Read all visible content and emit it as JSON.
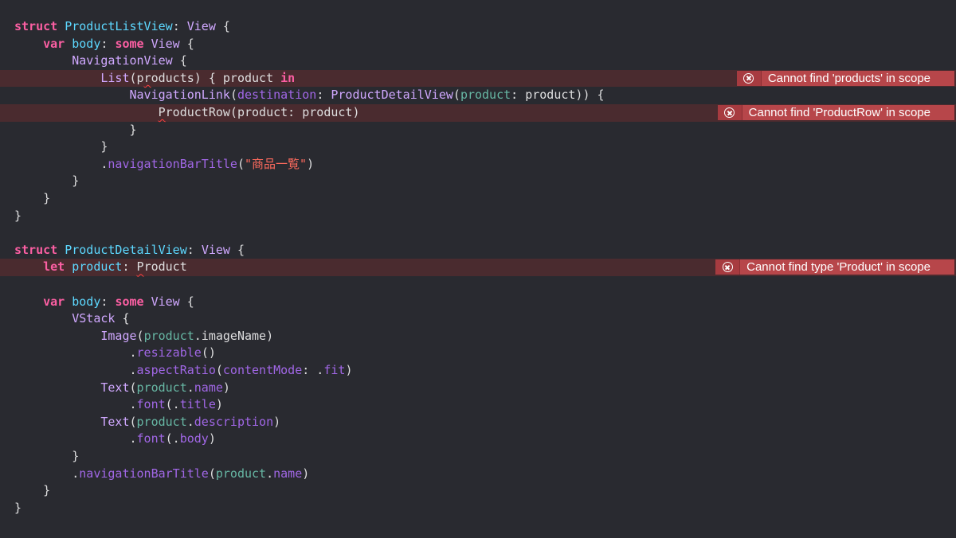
{
  "editor": {
    "lines": [
      [
        [
          "kw",
          "struct "
        ],
        [
          "decl",
          "ProductListView"
        ],
        [
          "plain",
          ": "
        ],
        [
          "type",
          "View"
        ],
        [
          "plain",
          " {"
        ]
      ],
      [
        [
          "plain",
          "    "
        ],
        [
          "kw",
          "var "
        ],
        [
          "decl",
          "body"
        ],
        [
          "plain",
          ": "
        ],
        [
          "kw",
          "some "
        ],
        [
          "type",
          "View"
        ],
        [
          "plain",
          " {"
        ]
      ],
      [
        [
          "plain",
          "        "
        ],
        [
          "type",
          "NavigationView"
        ],
        [
          "plain",
          " {"
        ]
      ],
      [
        [
          "plain",
          "            "
        ],
        [
          "type",
          "List"
        ],
        [
          "plain",
          "("
        ],
        [
          "plain",
          "p"
        ],
        [
          "squig",
          "r"
        ],
        [
          "plain",
          "oducts) { product "
        ],
        [
          "kw",
          "in"
        ]
      ],
      [
        [
          "plain",
          "                "
        ],
        [
          "type",
          "NavigationLink"
        ],
        [
          "plain",
          "("
        ],
        [
          "func",
          "destination"
        ],
        [
          "plain",
          ": "
        ],
        [
          "type",
          "ProductDetailView"
        ],
        [
          "plain",
          "("
        ],
        [
          "prop",
          "product"
        ],
        [
          "plain",
          ": product)) {"
        ]
      ],
      [
        [
          "plain",
          "                    "
        ],
        [
          "squig",
          "P"
        ],
        [
          "plain",
          "roductRow(product: product)"
        ]
      ],
      [
        [
          "plain",
          "                }"
        ]
      ],
      [
        [
          "plain",
          "            }"
        ]
      ],
      [
        [
          "plain",
          "            ."
        ],
        [
          "func",
          "navigationBarTitle"
        ],
        [
          "plain",
          "("
        ],
        [
          "str",
          "\"商品一覧\""
        ],
        [
          "plain",
          ")"
        ]
      ],
      [
        [
          "plain",
          "        }"
        ]
      ],
      [
        [
          "plain",
          "    }"
        ]
      ],
      [
        [
          "plain",
          "}"
        ]
      ],
      [],
      [
        [
          "kw",
          "struct "
        ],
        [
          "decl",
          "ProductDetailView"
        ],
        [
          "plain",
          ": "
        ],
        [
          "type",
          "View"
        ],
        [
          "plain",
          " {"
        ]
      ],
      [
        [
          "plain",
          "    "
        ],
        [
          "kw",
          "let "
        ],
        [
          "decl",
          "product"
        ],
        [
          "plain",
          ": "
        ],
        [
          "squig",
          "P"
        ],
        [
          "plain",
          "roduct"
        ]
      ],
      [],
      [
        [
          "plain",
          "    "
        ],
        [
          "kw",
          "var "
        ],
        [
          "decl",
          "body"
        ],
        [
          "plain",
          ": "
        ],
        [
          "kw",
          "some "
        ],
        [
          "type",
          "View"
        ],
        [
          "plain",
          " {"
        ]
      ],
      [
        [
          "plain",
          "        "
        ],
        [
          "type",
          "VStack"
        ],
        [
          "plain",
          " {"
        ]
      ],
      [
        [
          "plain",
          "            "
        ],
        [
          "type",
          "Image"
        ],
        [
          "plain",
          "("
        ],
        [
          "prop",
          "product"
        ],
        [
          "plain",
          ".imageName)"
        ]
      ],
      [
        [
          "plain",
          "                ."
        ],
        [
          "func",
          "resizable"
        ],
        [
          "plain",
          "()"
        ]
      ],
      [
        [
          "plain",
          "                ."
        ],
        [
          "func",
          "aspectRatio"
        ],
        [
          "plain",
          "("
        ],
        [
          "func",
          "contentMode"
        ],
        [
          "plain",
          ": ."
        ],
        [
          "func",
          "fit"
        ],
        [
          "plain",
          ")"
        ]
      ],
      [
        [
          "plain",
          "            "
        ],
        [
          "type",
          "Text"
        ],
        [
          "plain",
          "("
        ],
        [
          "prop",
          "product"
        ],
        [
          "plain",
          "."
        ],
        [
          "func",
          "name"
        ],
        [
          "plain",
          ")"
        ]
      ],
      [
        [
          "plain",
          "                ."
        ],
        [
          "func",
          "font"
        ],
        [
          "plain",
          "(."
        ],
        [
          "func",
          "title"
        ],
        [
          "plain",
          ")"
        ]
      ],
      [
        [
          "plain",
          "            "
        ],
        [
          "type",
          "Text"
        ],
        [
          "plain",
          "("
        ],
        [
          "prop",
          "product"
        ],
        [
          "plain",
          "."
        ],
        [
          "func",
          "description"
        ],
        [
          "plain",
          ")"
        ]
      ],
      [
        [
          "plain",
          "                ."
        ],
        [
          "func",
          "font"
        ],
        [
          "plain",
          "(."
        ],
        [
          "func",
          "body"
        ],
        [
          "plain",
          ")"
        ]
      ],
      [
        [
          "plain",
          "        }"
        ]
      ],
      [
        [
          "plain",
          "        ."
        ],
        [
          "func",
          "navigationBarTitle"
        ],
        [
          "plain",
          "("
        ],
        [
          "prop",
          "product"
        ],
        [
          "plain",
          "."
        ],
        [
          "func",
          "name"
        ],
        [
          "plain",
          ")"
        ]
      ],
      [
        [
          "plain",
          "    }"
        ]
      ],
      [
        [
          "plain",
          "}"
        ]
      ]
    ],
    "errors": [
      {
        "line_index": 3,
        "message": "Cannot find 'products' in scope"
      },
      {
        "line_index": 5,
        "message": "Cannot find 'ProductRow' in scope"
      },
      {
        "line_index": 14,
        "message": "Cannot find type 'Product' in scope"
      }
    ]
  }
}
